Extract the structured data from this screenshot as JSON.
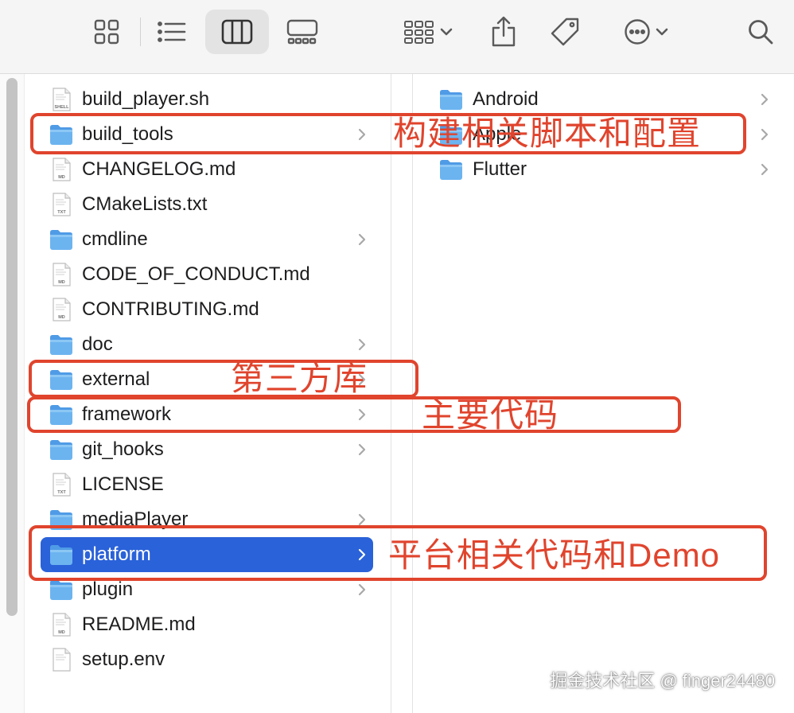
{
  "toolbar": {
    "buttons": [
      {
        "name": "icon-view-button",
        "icon": "grid-icon"
      },
      {
        "name": "list-view-button",
        "icon": "list-icon"
      },
      {
        "name": "column-view-button",
        "icon": "columns-icon",
        "active": true
      },
      {
        "name": "gallery-view-button",
        "icon": "gallery-icon"
      },
      {
        "name": "group-button",
        "icon": "group-grid-icon"
      },
      {
        "name": "share-button",
        "icon": "share-icon"
      },
      {
        "name": "tag-button",
        "icon": "tag-icon"
      },
      {
        "name": "more-actions-button",
        "icon": "ellipsis-circle-icon"
      },
      {
        "name": "search-button",
        "icon": "search-icon"
      }
    ]
  },
  "column1": {
    "items": [
      {
        "name": "build_player.sh",
        "kind": "doc",
        "badge": "SHELL"
      },
      {
        "name": "build_tools",
        "kind": "folder"
      },
      {
        "name": "CHANGELOG.md",
        "kind": "doc",
        "badge": "MD"
      },
      {
        "name": "CMakeLists.txt",
        "kind": "doc",
        "badge": "TXT"
      },
      {
        "name": "cmdline",
        "kind": "folder"
      },
      {
        "name": "CODE_OF_CONDUCT.md",
        "kind": "doc",
        "badge": "MD"
      },
      {
        "name": "CONTRIBUTING.md",
        "kind": "doc",
        "badge": "MD"
      },
      {
        "name": "doc",
        "kind": "folder"
      },
      {
        "name": "external",
        "kind": "folder"
      },
      {
        "name": "framework",
        "kind": "folder"
      },
      {
        "name": "git_hooks",
        "kind": "folder"
      },
      {
        "name": "LICENSE",
        "kind": "doc",
        "badge": "TXT"
      },
      {
        "name": "mediaPlayer",
        "kind": "folder"
      },
      {
        "name": "platform",
        "kind": "folder",
        "selected": true
      },
      {
        "name": "plugin",
        "kind": "folder"
      },
      {
        "name": "README.md",
        "kind": "doc",
        "badge": "MD"
      },
      {
        "name": "setup.env",
        "kind": "doc",
        "badge": ""
      }
    ]
  },
  "column2": {
    "items": [
      {
        "name": "Android",
        "kind": "folder"
      },
      {
        "name": "Apple",
        "kind": "folder"
      },
      {
        "name": "Flutter",
        "kind": "folder"
      }
    ]
  },
  "annotations": {
    "build_tools_note": "构建相关脚本和配置",
    "external_note": "第三方库",
    "framework_note": "主要代码",
    "platform_note": "平台相关代码和Demo"
  },
  "watermark": "掘金技术社区 @ finger24480",
  "colors": {
    "selection": "#2a62d9",
    "folder": "#6cb4f0",
    "annotation": "#e0442d"
  }
}
